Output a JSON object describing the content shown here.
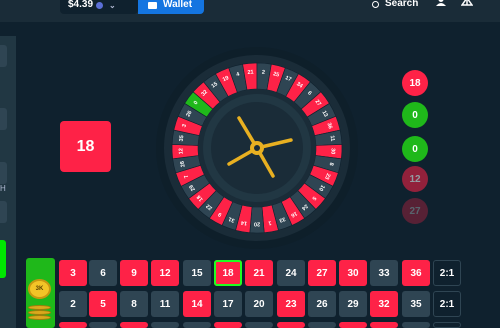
{
  "topbar": {
    "balance": "$4.39",
    "wallet_label": "Wallet",
    "search_label": "Search"
  },
  "sidebar": {
    "letter": "H"
  },
  "result": {
    "number": "18",
    "color": "#fe2247"
  },
  "history": [
    {
      "value": "18",
      "color": "red"
    },
    {
      "value": "0",
      "color": "green"
    },
    {
      "value": "0",
      "color": "green"
    },
    {
      "value": "12",
      "color": "red"
    },
    {
      "value": "27",
      "color": "red"
    }
  ],
  "wheel": {
    "pockets": [
      "0",
      "32",
      "15",
      "19",
      "4",
      "21",
      "2",
      "25",
      "17",
      "34",
      "6",
      "27",
      "13",
      "36",
      "11",
      "30",
      "8",
      "23",
      "10",
      "5",
      "24",
      "16",
      "33",
      "1",
      "20",
      "14",
      "31",
      "9",
      "22",
      "18",
      "29",
      "7",
      "28",
      "12",
      "35",
      "3",
      "26"
    ],
    "red_numbers": [
      1,
      3,
      5,
      7,
      9,
      12,
      14,
      16,
      18,
      19,
      21,
      23,
      25,
      27,
      30,
      32,
      34,
      36
    ],
    "ball_number": "22"
  },
  "board": {
    "chip_label": "3K",
    "rows": [
      [
        "3",
        "6",
        "9",
        "12",
        "15",
        "18",
        "21",
        "24",
        "27",
        "30",
        "33",
        "36",
        "2:1"
      ],
      [
        "2",
        "5",
        "8",
        "11",
        "14",
        "17",
        "20",
        "23",
        "26",
        "29",
        "32",
        "35",
        "2:1"
      ]
    ],
    "selected": "18"
  },
  "colors": {
    "red": "#fe2247",
    "black": "#2f4553",
    "green": "#1fb81a",
    "accent": "#1475e1",
    "background": "#0f212e"
  }
}
